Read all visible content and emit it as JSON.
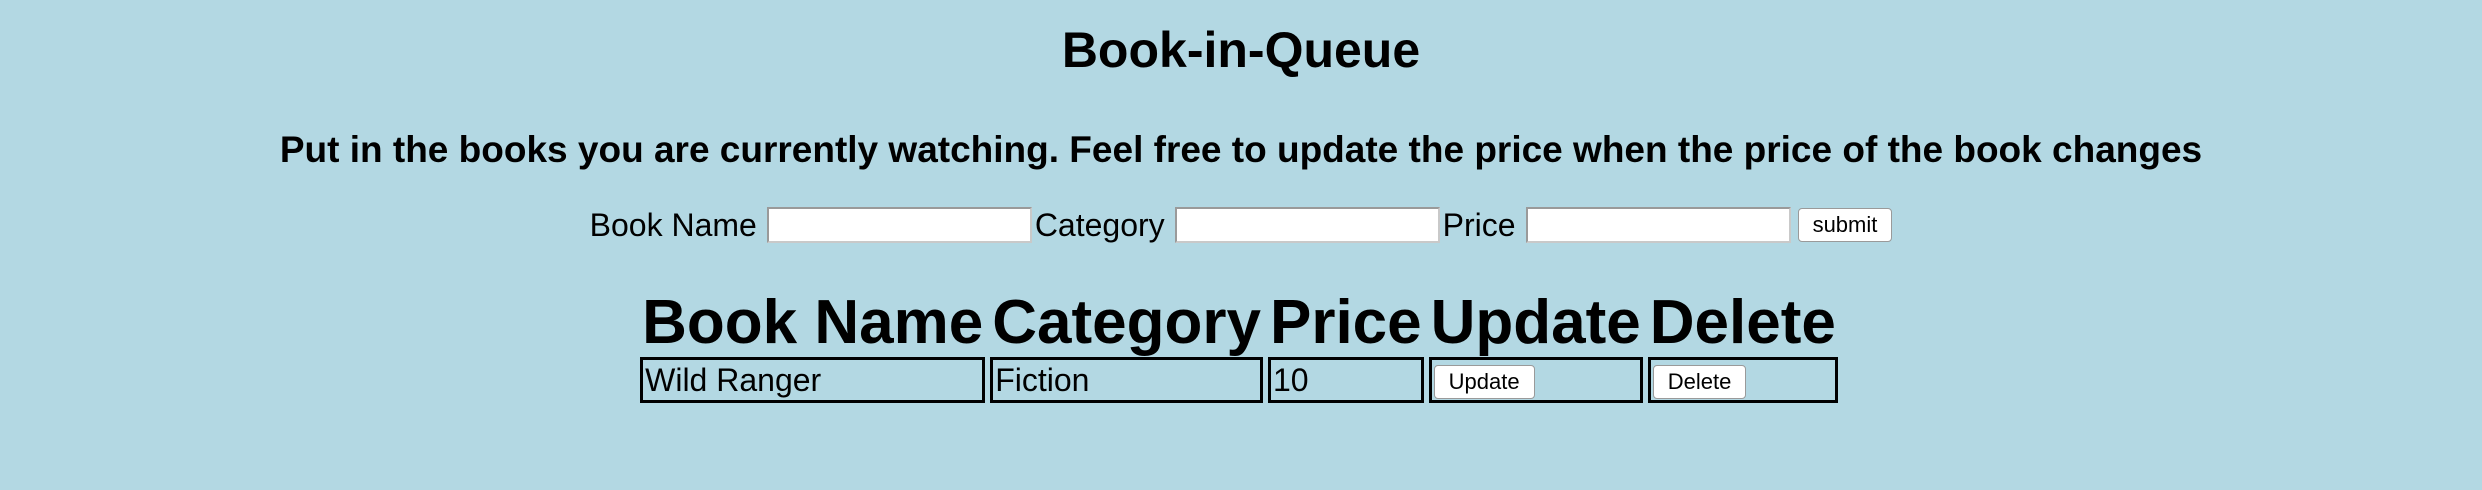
{
  "page": {
    "title": "Book-in-Queue",
    "subtitle": "Put in the books you are currently watching. Feel free to update the price when the price of the book changes"
  },
  "form": {
    "book_name_label": "Book Name",
    "book_name_value": "",
    "category_label": "Category",
    "category_value": "",
    "price_label": "Price",
    "price_value": "",
    "submit_label": "submit"
  },
  "table": {
    "headers": [
      "Book Name",
      "Category",
      "Price",
      "Update",
      "Delete"
    ],
    "rows": [
      {
        "book_name": "Wild Ranger",
        "category": "Fiction",
        "price": "10",
        "update_label": "Update",
        "delete_label": "Delete"
      }
    ]
  },
  "colors": {
    "background": "#b3d8e3"
  }
}
